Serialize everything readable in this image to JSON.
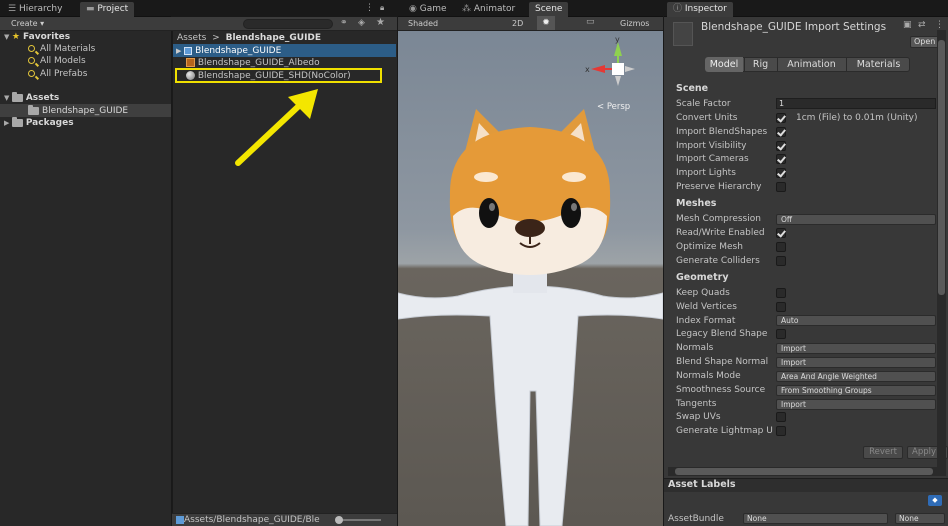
{
  "left_tabs": {
    "hierarchy": "Hierarchy",
    "project": "Project"
  },
  "create_label": "Create ▾",
  "favorites": {
    "header": "Favorites",
    "items": [
      "All Materials",
      "All Models",
      "All Prefabs"
    ]
  },
  "assets_tree": {
    "header": "Assets",
    "child": "Blendshape_GUIDE",
    "packages": "Packages"
  },
  "breadcrumb": {
    "root": "Assets",
    "sep": ">",
    "current": "Blendshape_GUIDE"
  },
  "files": [
    "Blendshape_GUIDE",
    "Blendshape_GUIDE_Albedo",
    "Blendshape_GUIDE_SHD(NoColor)"
  ],
  "bottom_path": "Assets/Blendshape_GUIDE/Ble",
  "scene_tabs": {
    "game": "Game",
    "animator": "Animator",
    "scene": "Scene"
  },
  "scene_toolbar": {
    "shading": "Shaded",
    "mode": "2D",
    "gizmos": "Gizmos"
  },
  "gizmo": {
    "x": "x",
    "y": "y",
    "persp": "< Persp"
  },
  "inspector": {
    "tab": "Inspector",
    "title": "Blendshape_GUIDE Import Settings",
    "open": "Open",
    "tabs": [
      "Model",
      "Rig",
      "Animation",
      "Materials"
    ],
    "scene": {
      "header": "Scene",
      "scale_factor_label": "Scale Factor",
      "scale_factor": "1",
      "convert_units": "Convert Units",
      "convert_note": "1cm (File) to 0.01m (Unity)",
      "import_blendshapes": "Import BlendShapes",
      "import_visibility": "Import Visibility",
      "import_cameras": "Import Cameras",
      "import_lights": "Import Lights",
      "preserve_hierarchy": "Preserve Hierarchy"
    },
    "meshes": {
      "header": "Meshes",
      "mesh_compression": "Mesh Compression",
      "mesh_compression_val": "Off",
      "read_write": "Read/Write Enabled",
      "optimize_mesh": "Optimize Mesh",
      "generate_colliders": "Generate Colliders"
    },
    "geometry": {
      "header": "Geometry",
      "keep_quads": "Keep Quads",
      "weld_vertices": "Weld Vertices",
      "index_format": "Index Format",
      "index_format_val": "Auto",
      "legacy_blend": "Legacy Blend Shape",
      "normals": "Normals",
      "normals_val": "Import",
      "blend_shape_normals": "Blend Shape Normal",
      "blend_shape_normals_val": "Import",
      "normals_mode": "Normals Mode",
      "normals_mode_val": "Area And Angle Weighted",
      "smoothness_source": "Smoothness Source",
      "smoothness_source_val": "From Smoothing Groups",
      "tangents": "Tangents",
      "tangents_val": "Import",
      "swap_uvs": "Swap UVs",
      "generate_lightmap": "Generate Lightmap U"
    },
    "revert": "Revert",
    "apply": "Apply",
    "asset_labels": "Asset Labels",
    "asset_bundle": "AssetBundle",
    "bundle_val": "None",
    "variant_val": "None"
  }
}
